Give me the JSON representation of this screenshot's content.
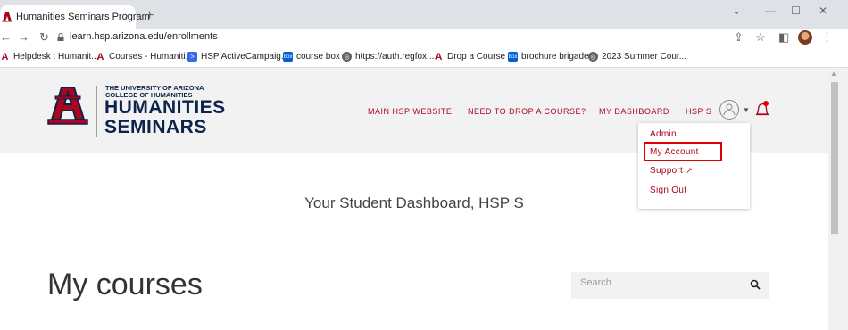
{
  "browser": {
    "tab_title": "Humanities Seminars Program",
    "tab_close": "×",
    "new_tab": "+",
    "url": "learn.hsp.arizona.edu/enrollments",
    "bookmarks": [
      {
        "label": "Helpdesk : Humanit...",
        "icon": "arizona-icon"
      },
      {
        "label": "Courses - Humaniti...",
        "icon": "arizona-icon"
      },
      {
        "label": "HSP ActiveCampaig...",
        "icon": "activecampaign-icon"
      },
      {
        "label": "course box",
        "icon": "box-icon"
      },
      {
        "label": "https://auth.regfox....",
        "icon": "globe-icon"
      },
      {
        "label": "Drop a Course",
        "icon": "arizona-icon"
      },
      {
        "label": "brochure brigade",
        "icon": "box-icon"
      },
      {
        "label": "2023 Summer Cour...",
        "icon": "globe-icon"
      }
    ]
  },
  "site": {
    "logo_small_line1": "THE UNIVERSITY OF ARIZONA",
    "logo_small_line2": "COLLEGE OF HUMANITIES",
    "logo_big_line1": "HUMANITIES",
    "logo_big_line2": "SEMINARS",
    "nav": {
      "main_site": "MAIN HSP WEBSITE",
      "drop_course": "NEED TO DROP A COURSE?",
      "dashboard": "MY DASHBOARD",
      "user": "HSP S"
    },
    "dropdown": {
      "admin": "Admin",
      "my_account": "My Account",
      "support": "Support",
      "sign_out": "Sign Out"
    },
    "brand_color": "#ab0520",
    "navy_color": "#0c234b",
    "highlight_color": "#e00000"
  },
  "main": {
    "dashboard_title": "Your Student Dashboard, HSP S",
    "courses_heading": "My courses",
    "search_placeholder": "Search"
  }
}
